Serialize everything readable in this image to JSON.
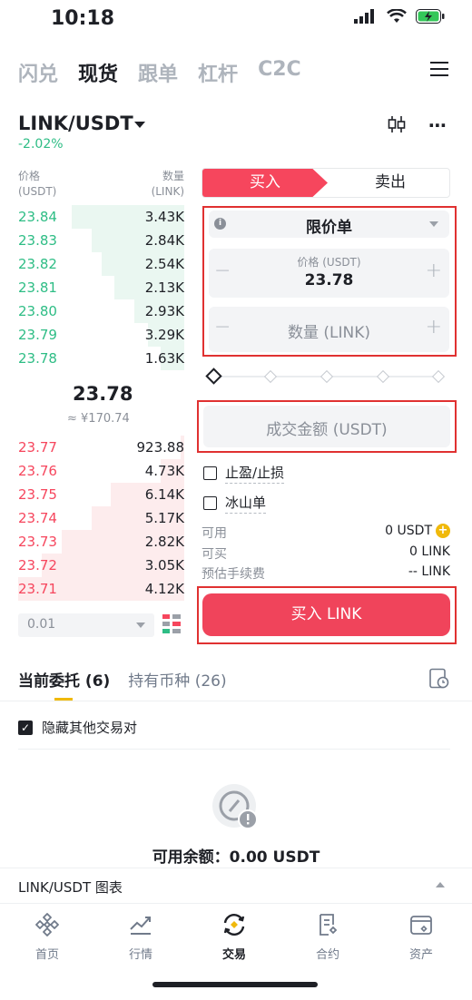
{
  "status": {
    "time": "10:18"
  },
  "top_tabs": [
    "闪兑",
    "现货",
    "跟单",
    "杠杆",
    "C2C"
  ],
  "pair": {
    "name": "LINK/USDT",
    "change": "-2.02%"
  },
  "orderbook": {
    "price_header": "价格",
    "price_unit": "(USDT)",
    "qty_header": "数量",
    "qty_unit": "(LINK)",
    "asks_label": "bids",
    "bids": [
      {
        "price": "23.84",
        "qty": "3.43K",
        "depth": 0.68
      },
      {
        "price": "23.83",
        "qty": "2.84K",
        "depth": 0.56
      },
      {
        "price": "23.82",
        "qty": "2.54K",
        "depth": 0.5
      },
      {
        "price": "23.81",
        "qty": "2.13K",
        "depth": 0.42
      },
      {
        "price": "23.80",
        "qty": "2.93K",
        "depth": 0.3
      },
      {
        "price": "23.79",
        "qty": "3.29K",
        "depth": 0.22
      },
      {
        "price": "23.78",
        "qty": "1.63K",
        "depth": 0.14
      }
    ],
    "mid_price": "23.78",
    "mid_fiat": "≈ ¥170.74",
    "asks": [
      {
        "price": "23.77",
        "qty": "923.88",
        "depth": 0.02
      },
      {
        "price": "23.76",
        "qty": "4.73K",
        "depth": 0.14
      },
      {
        "price": "23.75",
        "qty": "6.14K",
        "depth": 0.44
      },
      {
        "price": "23.74",
        "qty": "5.17K",
        "depth": 0.56
      },
      {
        "price": "23.73",
        "qty": "2.82K",
        "depth": 0.74
      },
      {
        "price": "23.72",
        "qty": "3.05K",
        "depth": 0.86
      },
      {
        "price": "23.71",
        "qty": "4.12K",
        "depth": 1.0
      }
    ],
    "depth_select": "0.01"
  },
  "form": {
    "buy_label": "买入",
    "sell_label": "卖出",
    "order_type": "限价单",
    "price_label": "价格 (USDT)",
    "price_value": "23.78",
    "qty_placeholder": "数量 (LINK)",
    "total_placeholder": "成交金额 (USDT)",
    "tpsl_label": "止盈/止损",
    "iceberg_label": "冰山单",
    "available_key": "可用",
    "available_value": "0 USDT",
    "can_buy_key": "可买",
    "can_buy_value": "0 LINK",
    "fee_key": "预估手续费",
    "fee_value": "-- LINK",
    "submit_label": "买入 LINK"
  },
  "orders": {
    "tab_current": "当前委托 (6)",
    "tab_holdings": "持有币种 (26)",
    "hide_other_label": "隐藏其他交易对",
    "available_balance": "可用余额：0.00 USDT"
  },
  "chart_bar": {
    "title": "LINK/USDT 图表"
  },
  "bottom_nav": [
    "首页",
    "行情",
    "交易",
    "合约",
    "资产"
  ],
  "colors": {
    "buy": "#2ebd85",
    "sell": "#f6465d",
    "accent": "#f0b90b"
  }
}
